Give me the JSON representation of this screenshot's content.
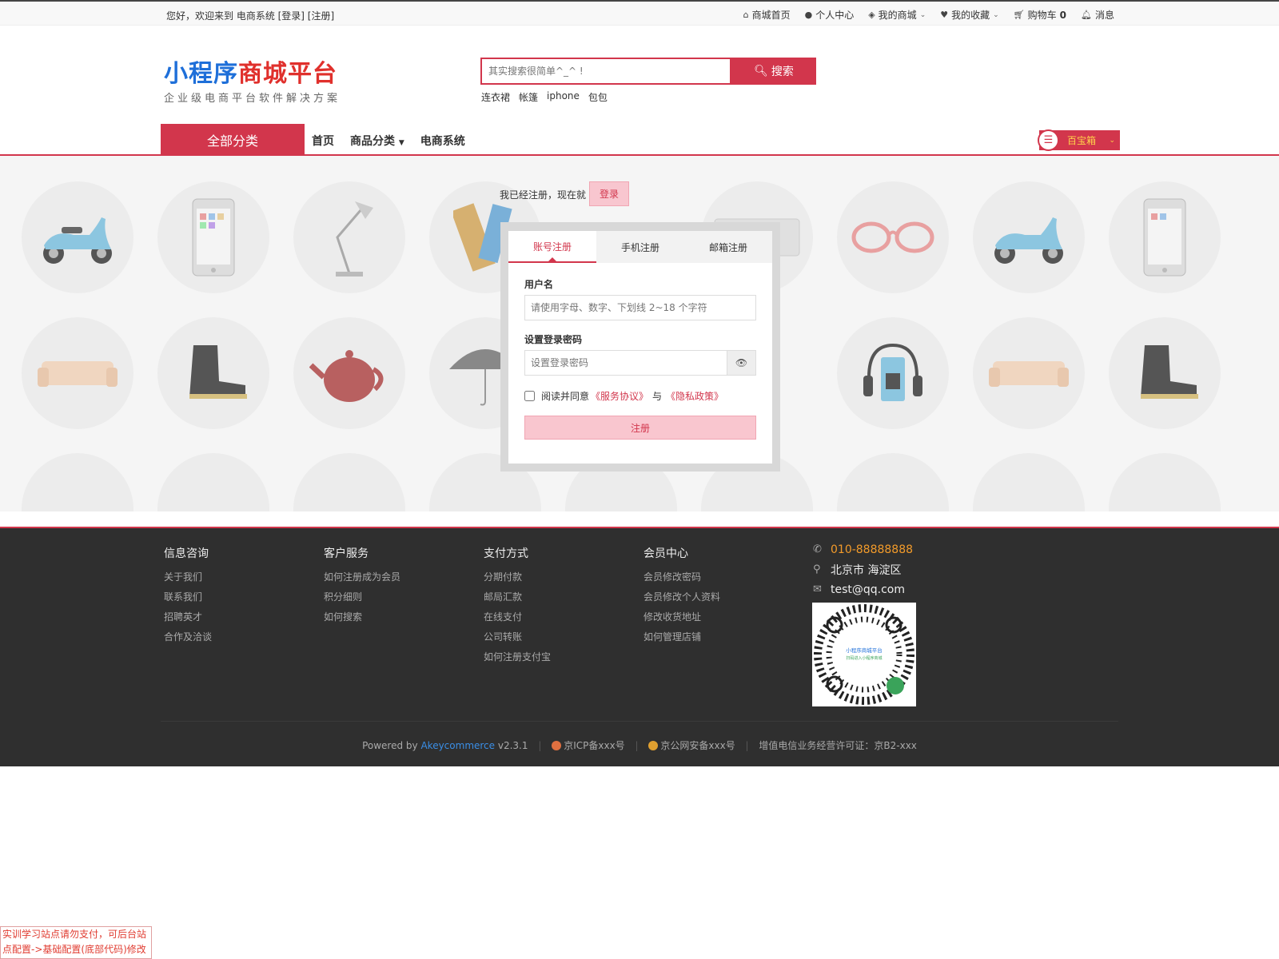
{
  "topbar": {
    "welcome": "您好，欢迎来到 电商系统 [登录] [注册]",
    "nav": [
      {
        "icon": "home-icon",
        "label": "商城首页"
      },
      {
        "icon": "user-icon",
        "label": "个人中心"
      },
      {
        "icon": "cube-icon",
        "label": "我的商城"
      },
      {
        "icon": "heart-icon",
        "label": "我的收藏"
      },
      {
        "icon": "cart-icon",
        "label": "购物车",
        "count": "0"
      },
      {
        "icon": "bell-icon",
        "label": "消息"
      }
    ]
  },
  "logo": {
    "title_blue": "小程序",
    "title_red": "商城平台",
    "subtitle": "企业级电商平台软件解决方案"
  },
  "search": {
    "placeholder": "其实搜索很简单^_^ !",
    "button": "搜索",
    "hot_words": [
      "连衣裙",
      "帐篷",
      "iphone",
      "包包"
    ]
  },
  "nav": {
    "all_categories": "全部分类",
    "items": [
      "首页",
      "商品分类",
      "电商系统"
    ],
    "treasure_box": "百宝箱"
  },
  "register": {
    "already_text": "我已经注册，现在就",
    "login_button": "登录",
    "tabs": [
      "账号注册",
      "手机注册",
      "邮箱注册"
    ],
    "username_label": "用户名",
    "username_placeholder": "请使用字母、数字、下划线 2~18 个字符",
    "password_label": "设置登录密码",
    "password_placeholder": "设置登录密码",
    "agree_text": "阅读并同意",
    "service_agreement": "《服务协议》",
    "and_text": "与",
    "privacy_policy": "《隐私政策》",
    "submit": "注册"
  },
  "footer": {
    "columns": [
      {
        "title": "信息咨询",
        "links": [
          "关于我们",
          "联系我们",
          "招聘英才",
          "合作及洽谈"
        ]
      },
      {
        "title": "客户服务",
        "links": [
          "如何注册成为会员",
          "积分细则",
          "如何搜索"
        ]
      },
      {
        "title": "支付方式",
        "links": [
          "分期付款",
          "邮局汇款",
          "在线支付",
          "公司转账",
          "如何注册支付宝"
        ]
      },
      {
        "title": "会员中心",
        "links": [
          "会员修改密码",
          "会员修改个人资料",
          "修改收货地址",
          "如何管理店铺"
        ]
      }
    ],
    "contact": {
      "phone": "010-88888888",
      "address": "北京市 海淀区",
      "email": "test@qq.com"
    },
    "qr_text": [
      "小程序商城平台",
      "扫码进入小程序商城"
    ],
    "powered_by": "Powered by",
    "brand": "Akeycommerce",
    "version": "v2.3.1",
    "icp": "京ICP备xxx号",
    "police": "京公网安备xxx号",
    "license": "增值电信业务经营许可证：京B2-xxx"
  },
  "notice": "实训学习站点请勿支付，可后台站点配置->基础配置(底部代码)修改",
  "colors": {
    "accent": "#d2364c",
    "logo_blue": "#1e6fd9",
    "logo_red": "#e0302c",
    "footer_bg": "#2f2f2f",
    "phone": "#f39b2a"
  }
}
